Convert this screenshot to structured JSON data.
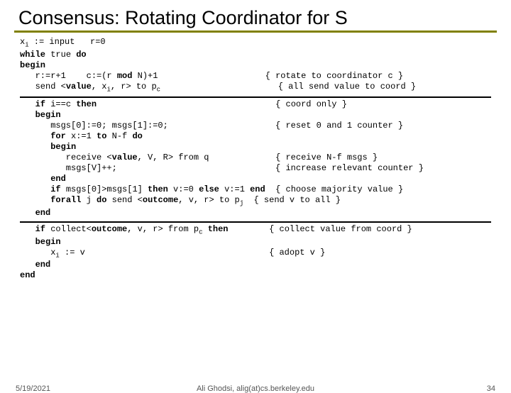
{
  "title": "Consensus: Rotating Coordinator for S",
  "code1": "x<sub>i</sub> := input   r=0\n<b>while</b> true <b>do</b>\n<b>begin</b>\n   r:=r+1    c:=(r <b>mod</b> N)+1                     { rotate to coordinator c }\n   send &lt;<b>value</b>, x<sub>i</sub>, r&gt; to p<sub>c</sub>                       { all send value to coord }",
  "code2": "   <b>if</b> i==c <b>then</b>                                   { coord only }\n   <b>begin</b>\n      msgs[0]:=0; msgs[1]:=0;                     { reset 0 and 1 counter }\n      <b>for</b> x:=1 <b>to</b> N-f <b>do</b>\n      <b>begin</b>\n         receive &lt;<b>value</b>, V, R&gt; from q             { receive N-f msgs }\n         msgs[V]++;                               { increase relevant counter }\n      <b>end</b>\n      <b>if</b> msgs[0]&gt;msgs[1] <b>then</b> v:=0 <b>else</b> v:=1 <b>end</b>  { choose majority value }\n      <b>forall</b> j <b>do</b> send &lt;<b>outcome</b>, v, r&gt; to p<sub>j</sub>  { send v to all }\n   <b>end</b>",
  "code3": "   <b>if</b> collect&lt;<b>outcome</b>, v, r&gt; from p<sub>c</sub> <b>then</b>        { collect value from coord }\n   <b>begin</b>\n      x<sub>i</sub> := v                                    { adopt v }\n   <b>end</b>\n<b>end</b>",
  "footer": {
    "date": "5/19/2021",
    "author": "Ali Ghodsi, alig(at)cs.berkeley.edu",
    "page": "34"
  }
}
